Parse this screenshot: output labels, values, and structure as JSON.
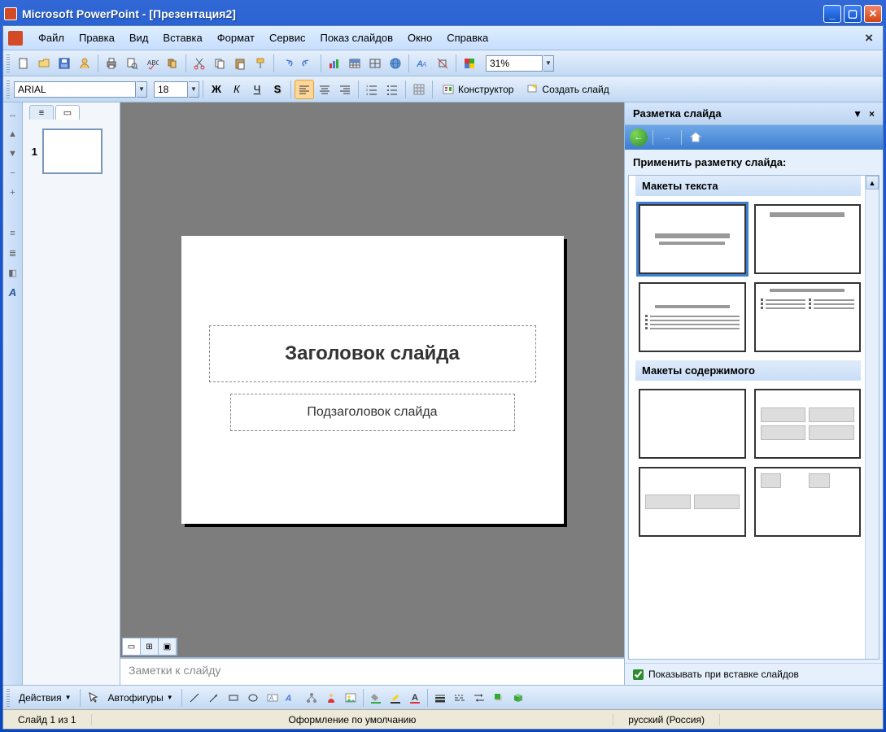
{
  "window": {
    "title": "Microsoft PowerPoint - [Презентация2]"
  },
  "menubar": {
    "items": [
      "Файл",
      "Правка",
      "Вид",
      "Вставка",
      "Формат",
      "Сервис",
      "Показ слайдов",
      "Окно",
      "Справка"
    ]
  },
  "toolbar1": {
    "zoom": "31%"
  },
  "toolbar2": {
    "font_name": "ARIAL",
    "font_size": "18",
    "bold": "Ж",
    "italic": "К",
    "underline": "Ч",
    "shadow": "S",
    "designer_label": "Конструктор",
    "newslide_label": "Создать слайд"
  },
  "thumbs": {
    "items": [
      {
        "num": "1"
      }
    ]
  },
  "slide": {
    "title_placeholder": "Заголовок слайда",
    "subtitle_placeholder": "Подзаголовок слайда"
  },
  "notes": {
    "placeholder": "Заметки к слайду"
  },
  "taskpane": {
    "title": "Разметка слайда",
    "apply_label": "Применить разметку слайда:",
    "cat1": "Макеты текста",
    "cat2": "Макеты содержимого",
    "footer_checkbox": "Показывать при вставке слайдов"
  },
  "drawbar": {
    "actions_label": "Действия",
    "autoshapes_label": "Автофигуры"
  },
  "statusbar": {
    "slide_info": "Слайд 1 из 1",
    "design": "Оформление по умолчанию",
    "lang": "русский (Россия)"
  }
}
